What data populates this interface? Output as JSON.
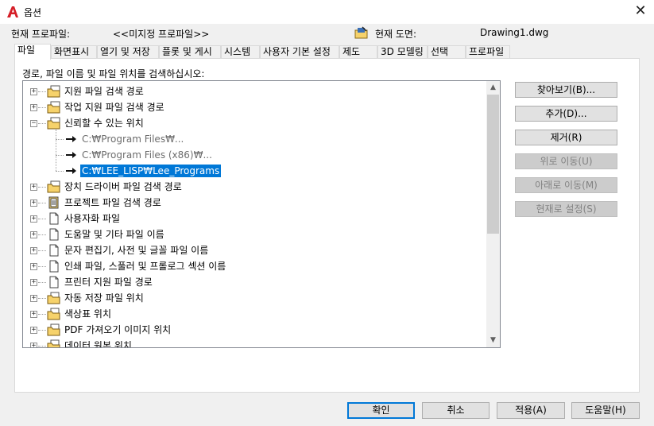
{
  "window": {
    "title": "옵션"
  },
  "header": {
    "profile_label": "현재 프로파일:",
    "profile_value": "<<미지정 프로파일>>",
    "drawing_label": "현재 도면:",
    "drawing_value": "Drawing1.dwg"
  },
  "tabs": [
    {
      "label": "파일",
      "active": true
    },
    {
      "label": "화면표시"
    },
    {
      "label": "열기 및 저장"
    },
    {
      "label": "플롯 및 게시"
    },
    {
      "label": "시스템"
    },
    {
      "label": "사용자 기본 설정"
    },
    {
      "label": "제도"
    },
    {
      "label": "3D 모델링"
    },
    {
      "label": "선택"
    },
    {
      "label": "프로파일"
    }
  ],
  "instruction": "경로, 파일 이름 및 파일 위치를 검색하십시오:",
  "tree": [
    {
      "label": "지원 파일 검색 경로",
      "icon": "folder-stack-icon",
      "expander": "+"
    },
    {
      "label": "작업 지원 파일 검색 경로",
      "icon": "folder-stack-icon",
      "expander": "+"
    },
    {
      "label": "신뢰할 수 있는 위치",
      "icon": "folder-stack-icon",
      "expander": "−"
    },
    {
      "label": "C:₩Program Files₩...",
      "icon": "arrow-icon",
      "gray": true,
      "child": true
    },
    {
      "label": "C:₩Program Files (x86)₩...",
      "icon": "arrow-icon",
      "gray": true,
      "child": true
    },
    {
      "label": "C:₩LEE_LISP₩Lee_Programs",
      "icon": "arrow-icon",
      "selected": true,
      "child": true
    },
    {
      "label": "장치 드라이버 파일 검색 경로",
      "icon": "folder-stack-icon",
      "expander": "+"
    },
    {
      "label": "프로젝트 파일 검색 경로",
      "icon": "project-file-icon",
      "expander": "+"
    },
    {
      "label": "사용자화 파일",
      "icon": "document-icon",
      "expander": "+"
    },
    {
      "label": "도움말 및 기타 파일 이름",
      "icon": "document-icon",
      "expander": "+"
    },
    {
      "label": "문자 편집기, 사전 및 글꼴 파일 이름",
      "icon": "document-icon",
      "expander": "+"
    },
    {
      "label": "인쇄 파일, 스풀러 및 프롤로그 섹션 이름",
      "icon": "document-icon",
      "expander": "+"
    },
    {
      "label": "프린터 지원 파일 경로",
      "icon": "document-icon",
      "expander": "+"
    },
    {
      "label": "자동 저장 파일 위치",
      "icon": "folder-icon",
      "expander": "+"
    },
    {
      "label": "색상표 위치",
      "icon": "folder-icon",
      "expander": "+"
    },
    {
      "label": "PDF 가져오기 이미지 위치",
      "icon": "folder-icon",
      "expander": "+"
    },
    {
      "label": "데이터 원본 위치",
      "icon": "folder-icon",
      "expander": "+"
    }
  ],
  "side_buttons": [
    {
      "label": "찾아보기(B)...",
      "enabled": true
    },
    {
      "label": "추가(D)...",
      "enabled": true
    },
    {
      "label": "제거(R)",
      "enabled": true
    },
    {
      "label": "위로 이동(U)",
      "enabled": false
    },
    {
      "label": "아래로 이동(M)",
      "enabled": false
    },
    {
      "label": "현재로 설정(S)",
      "enabled": false
    }
  ],
  "footer": {
    "ok": "확인",
    "cancel": "취소",
    "apply": "적용(A)",
    "help": "도움말(H)"
  },
  "colors": {
    "selection": "#0078d7",
    "autocad_red": "#d51f28",
    "folder_yellow": "#f6d26b"
  }
}
